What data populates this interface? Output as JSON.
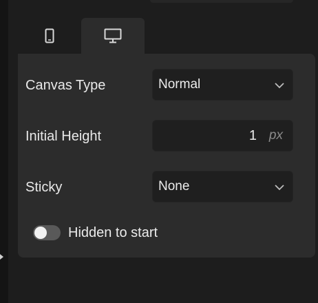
{
  "tabs": [
    {
      "icon": "mobile-icon",
      "active": false
    },
    {
      "icon": "desktop-icon",
      "active": true
    }
  ],
  "fields": {
    "canvas_type": {
      "label": "Canvas Type",
      "value": "Normal"
    },
    "initial_height": {
      "label": "Initial Height",
      "value": "1",
      "unit": "px"
    },
    "sticky": {
      "label": "Sticky",
      "value": "None"
    }
  },
  "hidden_toggle": {
    "label": "Hidden to start",
    "on": false
  },
  "colors": {
    "panel": "#2c2c2c",
    "field": "#1f1f1f",
    "background": "#1d1d1d"
  }
}
